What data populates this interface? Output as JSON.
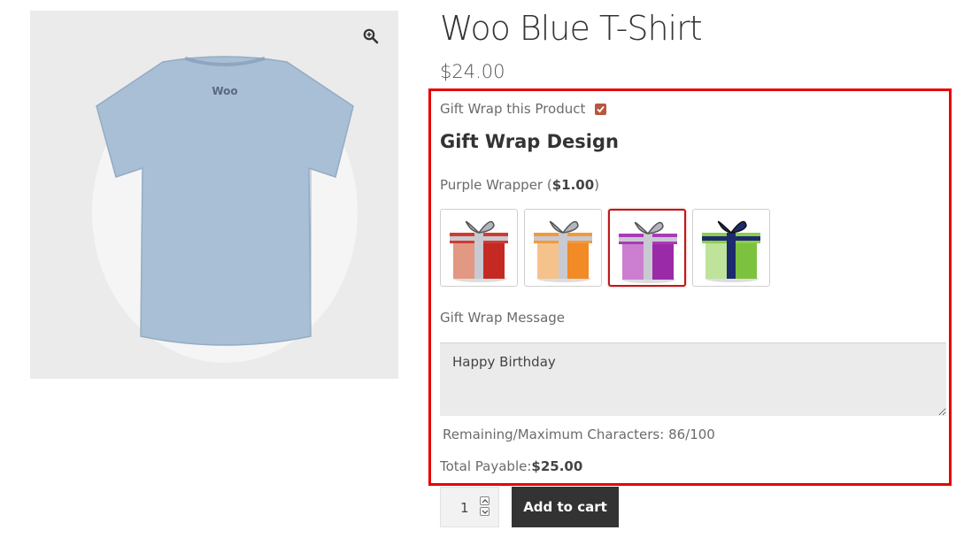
{
  "product": {
    "title": "Woo Blue T-Shirt",
    "price": "$24.00",
    "shirt_logo_text": "Woo",
    "shirt_color": "#a9bfd6"
  },
  "gift_wrap": {
    "toggle_label": "Gift Wrap this Product",
    "toggle_checked": true,
    "design_heading": "Gift Wrap Design",
    "selected_name": "Purple Wrapper (",
    "selected_price": "$1.00",
    "selected_suffix": ")",
    "options": [
      {
        "name": "red-wrapper",
        "box": "#c42a22",
        "ribbon": "#c9c9d2",
        "selected": false
      },
      {
        "name": "orange-wrapper",
        "box": "#f28a25",
        "ribbon": "#c9c9d2",
        "selected": false
      },
      {
        "name": "purple-wrapper",
        "box": "#9b2aa8",
        "ribbon": "#c9c9d2",
        "selected": true
      },
      {
        "name": "green-wrapper",
        "box": "#7cc23e",
        "ribbon": "#1e2a6e",
        "selected": false
      }
    ],
    "message_label": "Gift Wrap Message",
    "message_value": "Happy Birthday",
    "chars_label": "Remaining/Maximum Characters: 86/100",
    "total_label": "Total Payable:",
    "total_value": "$25.00"
  },
  "cart": {
    "quantity": "1",
    "button_label": "Add to cart"
  },
  "colors": {
    "highlight": "#e80000",
    "checkbox": "#b7573f",
    "button": "#333333"
  }
}
